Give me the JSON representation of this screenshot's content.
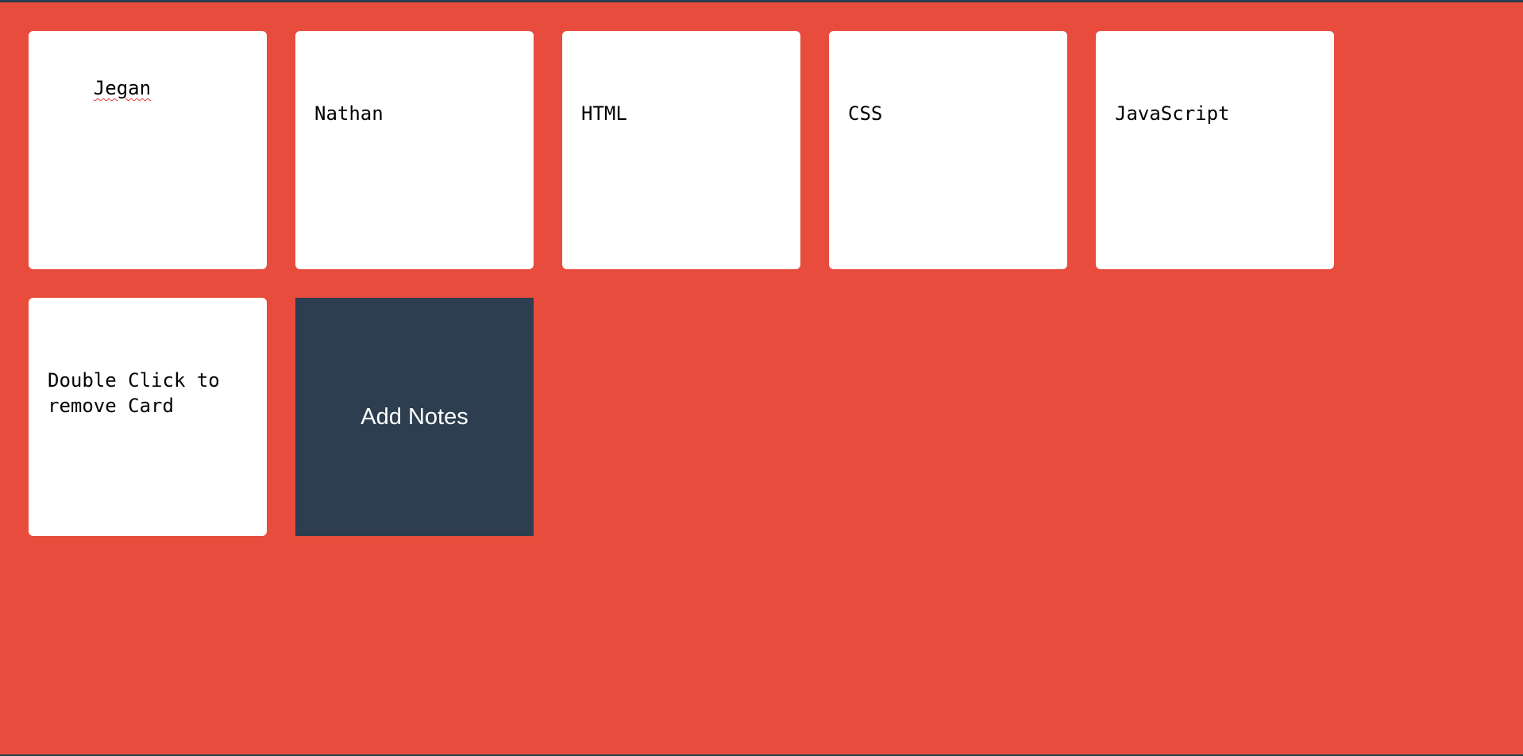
{
  "colors": {
    "background": "#e84c3d",
    "card": "#ffffff",
    "add_button": "#2c3e50",
    "text": "#000000",
    "add_button_text": "#ffffff"
  },
  "notes": [
    {
      "text": "Jegan",
      "spellcheck_flag": true
    },
    {
      "text": "Nathan",
      "spellcheck_flag": false
    },
    {
      "text": "HTML",
      "spellcheck_flag": false
    },
    {
      "text": "CSS",
      "spellcheck_flag": false
    },
    {
      "text": "JavaScript",
      "spellcheck_flag": false
    },
    {
      "text": "Double Click to remove Card",
      "spellcheck_flag": false
    }
  ],
  "add_button": {
    "label": "Add Notes"
  }
}
